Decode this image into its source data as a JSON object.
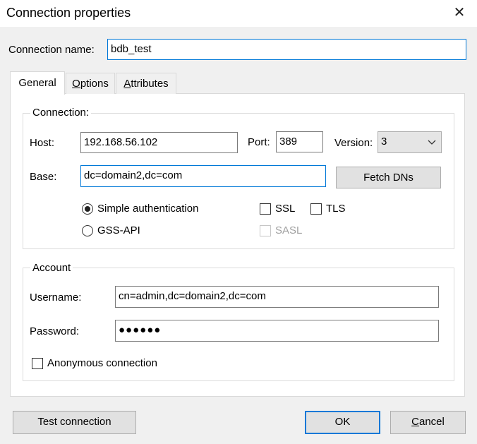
{
  "window": {
    "title": "Connection properties",
    "close_glyph": "✕"
  },
  "connection_name": {
    "label": "Connection name:",
    "value": "bdb_test"
  },
  "tabs": [
    {
      "label": "General",
      "active": true
    },
    {
      "label_accel": "O",
      "label_rest": "ptions"
    },
    {
      "label_accel": "A",
      "label_rest": "ttributes"
    }
  ],
  "connection_group": {
    "title": "Connection:",
    "host_label": "Host:",
    "host_value": "192.168.56.102",
    "port_label": "Port:",
    "port_value": "389",
    "version_label": "Version:",
    "version_value": "3",
    "base_label": "Base:",
    "base_value": "dc=domain2,dc=com",
    "fetch_dns_label": "Fetch DNs",
    "simple_auth_label": "Simple authentication",
    "gss_api_label": "GSS-API",
    "ssl_label": "SSL",
    "tls_label": "TLS",
    "sasl_label": "SASL"
  },
  "account_group": {
    "title": "Account",
    "username_label": "Username:",
    "username_value": "cn=admin,dc=domain2,dc=com",
    "password_label": "Password:",
    "password_value": "●●●●●●",
    "anonymous_label": "Anonymous connection"
  },
  "buttons": {
    "test_connection": "Test connection",
    "ok": "OK",
    "cancel_accel": "C",
    "cancel_rest": "ancel"
  }
}
